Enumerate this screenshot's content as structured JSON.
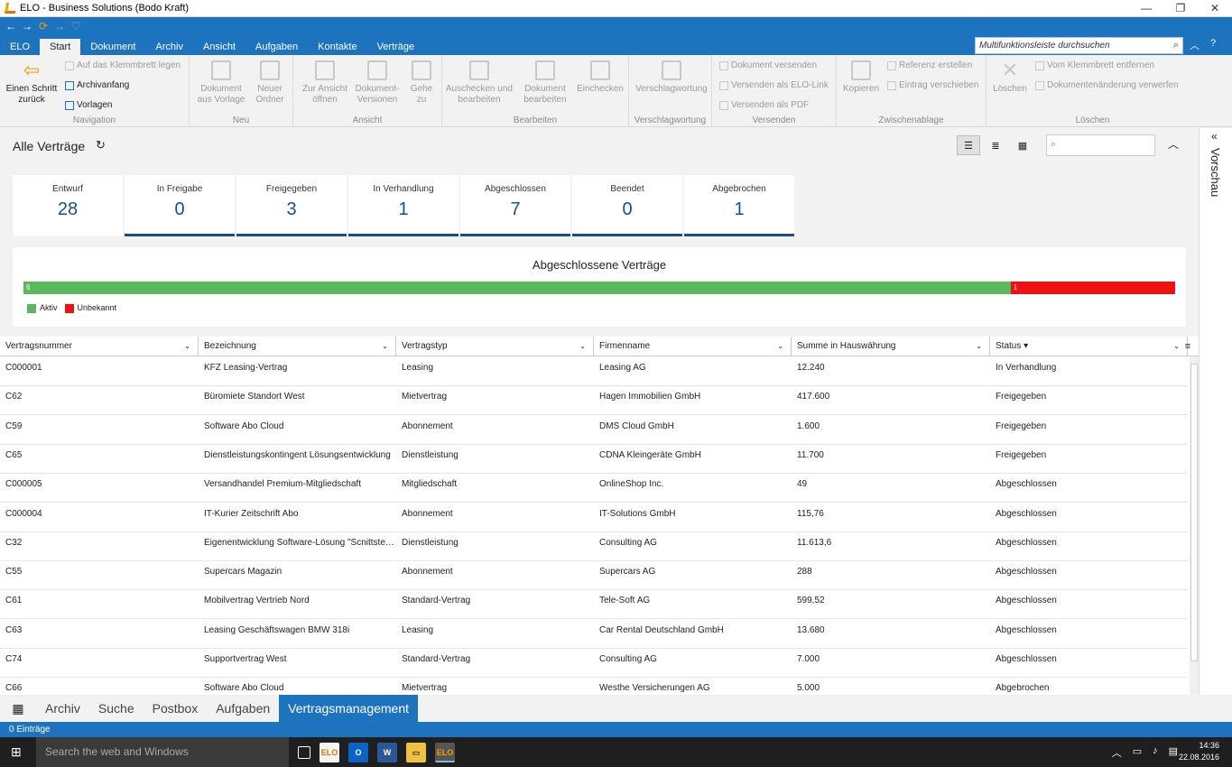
{
  "window": {
    "title": "ELO - Business Solutions (Bodo Kraft)",
    "minimize": "—",
    "restore": "❐",
    "close": "✕"
  },
  "ribbon_tabs": [
    "ELO",
    "Start",
    "Dokument",
    "Archiv",
    "Ansicht",
    "Aufgaben",
    "Kontakte",
    "Verträge"
  ],
  "ribbon_search_placeholder": "Multifunktionsleiste durchsuchen",
  "ribbon": {
    "nav": {
      "back": "Einen Schritt zurück",
      "clipboard": "Auf das Klemmbrett legen",
      "archive_start": "Archivanfang",
      "templates": "Vorlagen",
      "label": "Navigation"
    },
    "neu": {
      "doc_template": "Dokument aus Vorlage",
      "new_folder": "Neuer Ordner",
      "label": "Neu"
    },
    "ansicht": {
      "open_view": "Zur Ansicht öffnen",
      "doc_versions": "Dokument-Versionen",
      "goto": "Gehe zu",
      "label": "Ansicht"
    },
    "bearbeiten": {
      "checkout": "Auschecken und bearbeiten",
      "edit_doc": "Dokument bearbeiten",
      "checkin": "Einchecken",
      "label": "Bearbeiten"
    },
    "verschlag": {
      "btn": "Verschlagwortung",
      "label": "Verschlagwortung"
    },
    "versenden": {
      "send_doc": "Dokument versenden",
      "send_link": "Versenden als ELO-Link",
      "send_pdf": "Versenden als PDF",
      "label": "Versenden"
    },
    "zwischen": {
      "copy": "Kopieren",
      "ref": "Referenz erstellen",
      "move": "Eintrag verschieben",
      "label": "Zwischenablage"
    },
    "loeschen": {
      "delete": "Löschen",
      "remove_clip": "Vom Klemmbrett entfernen",
      "discard": "Dokumentenänderung verwerfen",
      "label": "Löschen"
    }
  },
  "page": {
    "title": "Alle Verträge",
    "filter_placeholder": "",
    "preview": "Vorschau"
  },
  "cards": [
    {
      "label": "Entwurf",
      "value": "28"
    },
    {
      "label": "In Freigabe",
      "value": "0"
    },
    {
      "label": "Freigegeben",
      "value": "3"
    },
    {
      "label": "In Verhandlung",
      "value": "1"
    },
    {
      "label": "Abgeschlossen",
      "value": "7"
    },
    {
      "label": "Beendet",
      "value": "0"
    },
    {
      "label": "Abgebrochen",
      "value": "1"
    }
  ],
  "chart_data": {
    "type": "bar",
    "title": "Abgeschlossene Verträge",
    "categories": [
      "Abgeschlossene Verträge"
    ],
    "series": [
      {
        "name": "Aktiv",
        "values": [
          6
        ],
        "color": "#5cb85c"
      },
      {
        "name": "Unbekannt",
        "values": [
          1
        ],
        "color": "#ee1111"
      }
    ],
    "stacked": true,
    "orientation": "horizontal",
    "legend": "bottom-left"
  },
  "table": {
    "columns": [
      "Vertragsnummer",
      "Bezeichnung",
      "Vertragstyp",
      "Firmenname",
      "Summe in Hauswährung",
      "Status"
    ],
    "rows": [
      [
        "C000001",
        "KFZ Leasing-Vertrag",
        "Leasing",
        "Leasing AG",
        "12.240",
        "In Verhandlung"
      ],
      [
        "C62",
        "Büromiete Standort West",
        "Mietvertrag",
        "Hagen Immobilien GmbH",
        "417.600",
        "Freigegeben"
      ],
      [
        "C59",
        "Software Abo Cloud",
        "Abonnement",
        "DMS Cloud GmbH",
        "1.600",
        "Freigegeben"
      ],
      [
        "C65",
        "Dienstleistungskontingent Lösungsentwicklung",
        "Dienstleistung",
        "CDNA Kleingeräte GmbH",
        "11.700",
        "Freigegeben"
      ],
      [
        "C000005",
        "Versandhandel Premium-Mitgliedschaft",
        "Mitgliedschaft",
        "OnlineShop Inc.",
        "49",
        "Abgeschlossen"
      ],
      [
        "C000004",
        "IT-Kurier Zeitschrift Abo",
        "Abonnement",
        "IT-Solutions GmbH",
        "115,76",
        "Abgeschlossen"
      ],
      [
        "C32",
        "Eigenentwicklung Software-Lösung \"Scnittstell...",
        "Dienstleistung",
        "Consulting AG",
        "11.613,6",
        "Abgeschlossen"
      ],
      [
        "C55",
        "Supercars Magazin",
        "Abonnement",
        "Supercars AG",
        "288",
        "Abgeschlossen"
      ],
      [
        "C61",
        "Mobilvertrag Vertrieb Nord",
        "Standard-Vertrag",
        "Tele-Soft AG",
        "599,52",
        "Abgeschlossen"
      ],
      [
        "C63",
        "Leasing Geschäftswagen BMW 318i",
        "Leasing",
        "Car Rental Deutschland GmbH",
        "13.680",
        "Abgeschlossen"
      ],
      [
        "C74",
        "Supportvertrag West",
        "Standard-Vertrag",
        "Consulting AG",
        "7.000",
        "Abgeschlossen"
      ],
      [
        "C66",
        "Software Abo Cloud",
        "Mietvertrag",
        "Westhe Versicherungen AG",
        "5.000",
        "Abgebrochen"
      ]
    ]
  },
  "bottom_tabs": [
    "Archiv",
    "Suche",
    "Postbox",
    "Aufgaben",
    "Vertragsmanagement"
  ],
  "status": "0 Einträge",
  "taskbar": {
    "search": "Search the web and Windows",
    "time": "14:36",
    "date": "22.08.2016"
  }
}
